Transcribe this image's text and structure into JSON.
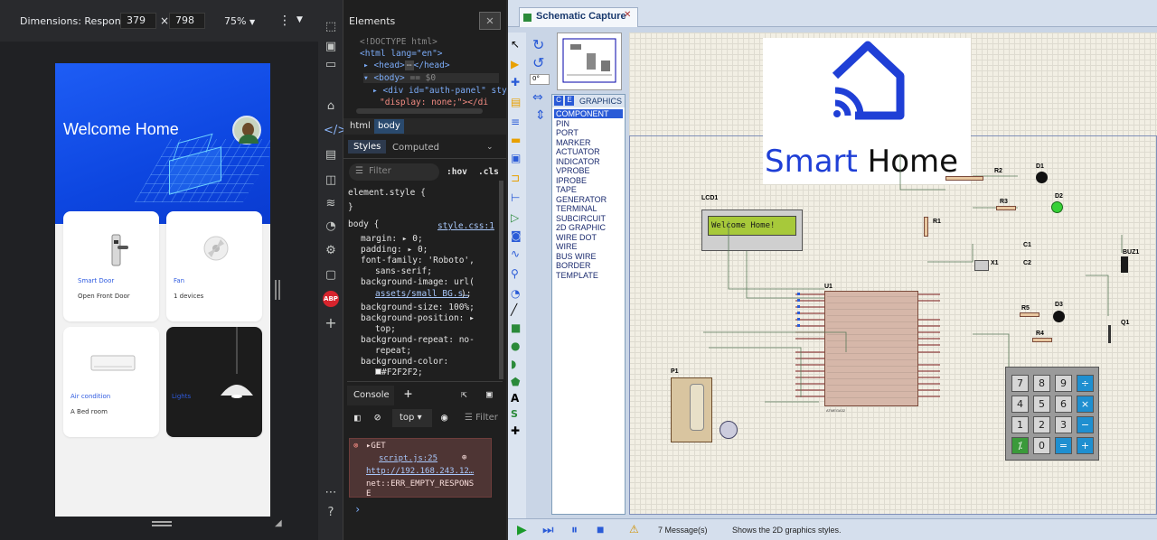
{
  "device_toolbar": {
    "dimensions_label": "Dimensions: Responsive",
    "width": "379",
    "height": "798",
    "times": "×",
    "zoom": "75%"
  },
  "phone_app": {
    "title": "Welcome Home",
    "cards": [
      {
        "name": "Smart Door",
        "sub": "Open Front Door"
      },
      {
        "name": "Fan",
        "sub": "1 devices"
      },
      {
        "name": "Air condition",
        "sub": "A Bed room"
      },
      {
        "name": "Lights",
        "sub": ""
      }
    ]
  },
  "devtools": {
    "panel_title": "Elements",
    "dom_lines": [
      "<!DOCTYPE html>",
      "<html lang=\"en\">",
      "<head>",
      "</head>",
      "<body>",
      "== $0",
      "<div id=\"auth-panel\" sty",
      "\"display: none;\"></di"
    ],
    "breadcrumbs": [
      "html",
      "body"
    ],
    "styles_tab": "Styles",
    "computed_tab": "Computed",
    "filter_placeholder": "Filter",
    "hov": ":hov",
    "cls": ".cls",
    "element_style": "element.style {",
    "close_brace": "}",
    "body_selector": "body {",
    "body_source": "style.css:1",
    "css": [
      {
        "name": "margin",
        "value": "0;"
      },
      {
        "name": "padding",
        "value": "0;"
      },
      {
        "name": "font-family",
        "value": "'Roboto',"
      },
      {
        "name": "",
        "value": "sans-serif;"
      },
      {
        "name": "background-image",
        "value": "url("
      },
      {
        "name": "",
        "value": "assets/small BG.s…"
      },
      {
        "name": "background-size",
        "value": "100%;"
      },
      {
        "name": "background-position",
        "value": ""
      },
      {
        "name": "",
        "value": "top;"
      },
      {
        "name": "background-repeat",
        "value": "no-"
      },
      {
        "name": "",
        "value": "repeat;"
      },
      {
        "name": "background-color",
        "value": ""
      },
      {
        "name": "",
        "value": "#F2F2F2;"
      }
    ],
    "console": {
      "tab": "Console",
      "context": "top",
      "filter": "Filter",
      "error": {
        "method": "GET",
        "source": "script.js:25",
        "url": "http://192.168.243.12…",
        "message1": "net::ERR_EMPTY_RESPONS",
        "message2": "E"
      },
      "prompt": "›"
    },
    "rail_badge": "ABP"
  },
  "proteus": {
    "tab_title": "Schematic Capture",
    "rotation": "0°",
    "list_header_c": "C",
    "list_header_e": "E",
    "list_header": "GRAPHICS",
    "graphics_items": [
      "COMPONENT",
      "PIN",
      "PORT",
      "MARKER",
      "ACTUATOR",
      "INDICATOR",
      "VPROBE",
      "IPROBE",
      "TAPE",
      "GENERATOR",
      "TERMINAL",
      "SUBCIRCUIT",
      "2D GRAPHIC",
      "WIRE DOT",
      "WIRE",
      "BUS WIRE",
      "BORDER",
      "TEMPLATE"
    ],
    "selected_item": "COMPONENT",
    "logo_text_a": "Smart",
    "logo_text_b": "Home",
    "lcd_label": "LCD1",
    "lcd_text": "Welcome Home!",
    "mcu_label": "U1",
    "mcu_part": "ATMEGA32",
    "components": [
      "R1",
      "R2",
      "R3",
      "R4",
      "R5",
      "D1",
      "D2",
      "D3",
      "C1",
      "C2",
      "X1",
      "BUZ1",
      "Q1",
      "P1"
    ],
    "keypad": [
      "7",
      "8",
      "9",
      "÷",
      "4",
      "5",
      "6",
      "×",
      "1",
      "2",
      "3",
      "−",
      "⁒",
      "0",
      "=",
      "+"
    ],
    "status_messages": "7 Message(s)",
    "status_hint": "Shows the 2D graphics styles.",
    "accent": "#1f3fd6"
  }
}
